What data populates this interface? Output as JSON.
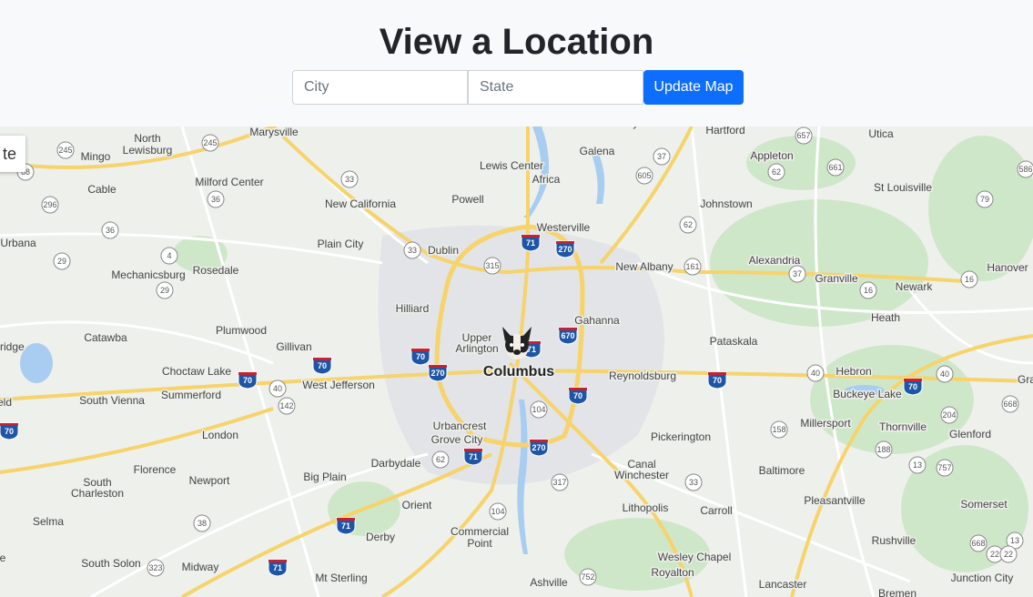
{
  "header": {
    "title": "View a Location",
    "city_placeholder": "City",
    "state_placeholder": "State",
    "update_label": "Update Map"
  },
  "map": {
    "type_control_label": "te",
    "marker_icon": "french-bulldog-icon",
    "colors": {
      "land": "#eef0ec",
      "urban": "#e2e4e8",
      "park": "#cfe7c9",
      "water": "#a8cdf0",
      "highway": "#f6d36b",
      "road": "#ffffff"
    },
    "labels": [
      {
        "name": "Columbus",
        "major": true
      },
      {
        "name": "Marysville"
      },
      {
        "name": "North"
      },
      {
        "name": "Lewisburg"
      },
      {
        "name": "Mingo"
      },
      {
        "name": "Milford Center"
      },
      {
        "name": "Cable"
      },
      {
        "name": "Urbana"
      },
      {
        "name": "Mechanicsburg"
      },
      {
        "name": "Rosedale"
      },
      {
        "name": "New California"
      },
      {
        "name": "Plain City"
      },
      {
        "name": "Dublin"
      },
      {
        "name": "Powell"
      },
      {
        "name": "Lewis Center"
      },
      {
        "name": "Africa"
      },
      {
        "name": "Galena"
      },
      {
        "name": "Sunbury"
      },
      {
        "name": "Westerville"
      },
      {
        "name": "Hartford"
      },
      {
        "name": "Utica"
      },
      {
        "name": "Appleton"
      },
      {
        "name": "Johnstown"
      },
      {
        "name": "St Louisville"
      },
      {
        "name": "New Albany"
      },
      {
        "name": "Alexandria"
      },
      {
        "name": "Granville"
      },
      {
        "name": "Newark"
      },
      {
        "name": "Hanover"
      },
      {
        "name": "Hilliard"
      },
      {
        "name": "Upper"
      },
      {
        "name": "Arlington"
      },
      {
        "name": "Gahanna"
      },
      {
        "name": "Heath"
      },
      {
        "name": "Pataskala"
      },
      {
        "name": "Plumwood"
      },
      {
        "name": "Catawba"
      },
      {
        "name": "Gillivan"
      },
      {
        "name": "Choctaw Lake"
      },
      {
        "name": "nridge"
      },
      {
        "name": "Reynoldsburg"
      },
      {
        "name": "Hebron"
      },
      {
        "name": "Gra"
      },
      {
        "name": "West Jefferson"
      },
      {
        "name": "Summerford"
      },
      {
        "name": "South Vienna"
      },
      {
        "name": "eld"
      },
      {
        "name": "Buckeye Lake"
      },
      {
        "name": "Urbancrest"
      },
      {
        "name": "Grove City"
      },
      {
        "name": "Millersport"
      },
      {
        "name": "Thornville"
      },
      {
        "name": "Glenford"
      },
      {
        "name": "London"
      },
      {
        "name": "Pickerington"
      },
      {
        "name": "Darbydale"
      },
      {
        "name": "Canal"
      },
      {
        "name": "Winchester"
      },
      {
        "name": "Baltimore"
      },
      {
        "name": "Florence"
      },
      {
        "name": "Newport"
      },
      {
        "name": "Big Plain"
      },
      {
        "name": "South"
      },
      {
        "name": "Charleston"
      },
      {
        "name": "Pleasantville"
      },
      {
        "name": "Orient"
      },
      {
        "name": "Lithopolis"
      },
      {
        "name": "Carroll"
      },
      {
        "name": "Somerset"
      },
      {
        "name": "Selma"
      },
      {
        "name": "Commercial"
      },
      {
        "name": "Point"
      },
      {
        "name": "Derby"
      },
      {
        "name": "Rushville"
      },
      {
        "name": "Wesley Chapel"
      },
      {
        "name": "Royalton"
      },
      {
        "name": "South Solon"
      },
      {
        "name": "Midway"
      },
      {
        "name": "Mt Sterling"
      },
      {
        "name": "Ashville"
      },
      {
        "name": "Lancaster"
      },
      {
        "name": "Junction City"
      },
      {
        "name": "Bremen"
      },
      {
        "name": "e"
      }
    ],
    "shields": [
      {
        "num": "245"
      },
      {
        "num": "245"
      },
      {
        "num": "68"
      },
      {
        "num": "296"
      },
      {
        "num": "36"
      },
      {
        "num": "36"
      },
      {
        "num": "29"
      },
      {
        "num": "4"
      },
      {
        "num": "29"
      },
      {
        "num": "33"
      },
      {
        "num": "33"
      },
      {
        "num": "315"
      },
      {
        "num": "37"
      },
      {
        "num": "605"
      },
      {
        "num": "657"
      },
      {
        "num": "62"
      },
      {
        "num": "661"
      },
      {
        "num": "586"
      },
      {
        "num": "79"
      },
      {
        "num": "62"
      },
      {
        "num": "161"
      },
      {
        "num": "37"
      },
      {
        "num": "16"
      },
      {
        "num": "16"
      },
      {
        "num": "40"
      },
      {
        "num": "142"
      },
      {
        "num": "40"
      },
      {
        "num": "40"
      },
      {
        "num": "668"
      },
      {
        "num": "204"
      },
      {
        "num": "104"
      },
      {
        "num": "158"
      },
      {
        "num": "188"
      },
      {
        "num": "13"
      },
      {
        "num": "757"
      },
      {
        "num": "62"
      },
      {
        "num": "33"
      },
      {
        "num": "317"
      },
      {
        "num": "38"
      },
      {
        "num": "104"
      },
      {
        "num": "323"
      },
      {
        "num": "752"
      },
      {
        "num": "22"
      },
      {
        "num": "668"
      },
      {
        "num": "13"
      },
      {
        "num": "22"
      }
    ],
    "interstates": [
      {
        "num": "71"
      },
      {
        "num": "270"
      },
      {
        "num": "670"
      },
      {
        "num": "70"
      },
      {
        "num": "70"
      },
      {
        "num": "270"
      },
      {
        "num": "70"
      },
      {
        "num": "70"
      },
      {
        "num": "70"
      },
      {
        "num": "70"
      },
      {
        "num": "70"
      },
      {
        "num": "270"
      },
      {
        "num": "71"
      },
      {
        "num": "71"
      },
      {
        "num": "71"
      },
      {
        "num": "71"
      }
    ]
  }
}
